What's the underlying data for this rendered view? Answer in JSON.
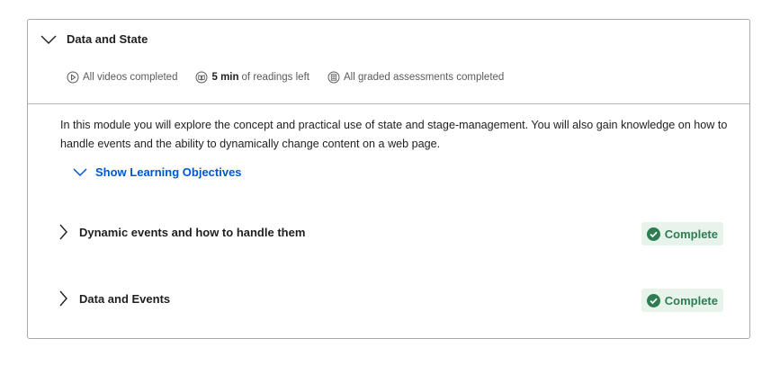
{
  "module": {
    "title": "Data and State",
    "expanded": true,
    "toggle_icon": "chevron-down-icon",
    "meta": {
      "videos": {
        "icon": "play-circle-icon",
        "text": "All videos completed"
      },
      "readings": {
        "icon": "reading-icon",
        "bold": "5 min",
        "text": "of readings left"
      },
      "assessments": {
        "icon": "assessment-icon",
        "text": "All graded assessments completed"
      }
    },
    "description": "In this module you will explore the concept and practical use of state and stage-management. You will also gain knowledge on how to handle events and the ability to dynamically change content on a web page.",
    "objectives_link": {
      "icon": "chevron-down-icon",
      "label": "Show Learning Objectives"
    },
    "lessons": [
      {
        "title": "Dynamic events and how to handle them",
        "status": "Complete",
        "icon": "chevron-right-icon",
        "status_icon": "check-circle-icon"
      },
      {
        "title": "Data and Events",
        "status": "Complete",
        "icon": "chevron-right-icon",
        "status_icon": "check-circle-icon"
      }
    ]
  },
  "colors": {
    "link": "#0056d2",
    "complete_text": "#2e7d52",
    "complete_bg": "#e8f3ec",
    "border": "#a8a8a8"
  }
}
